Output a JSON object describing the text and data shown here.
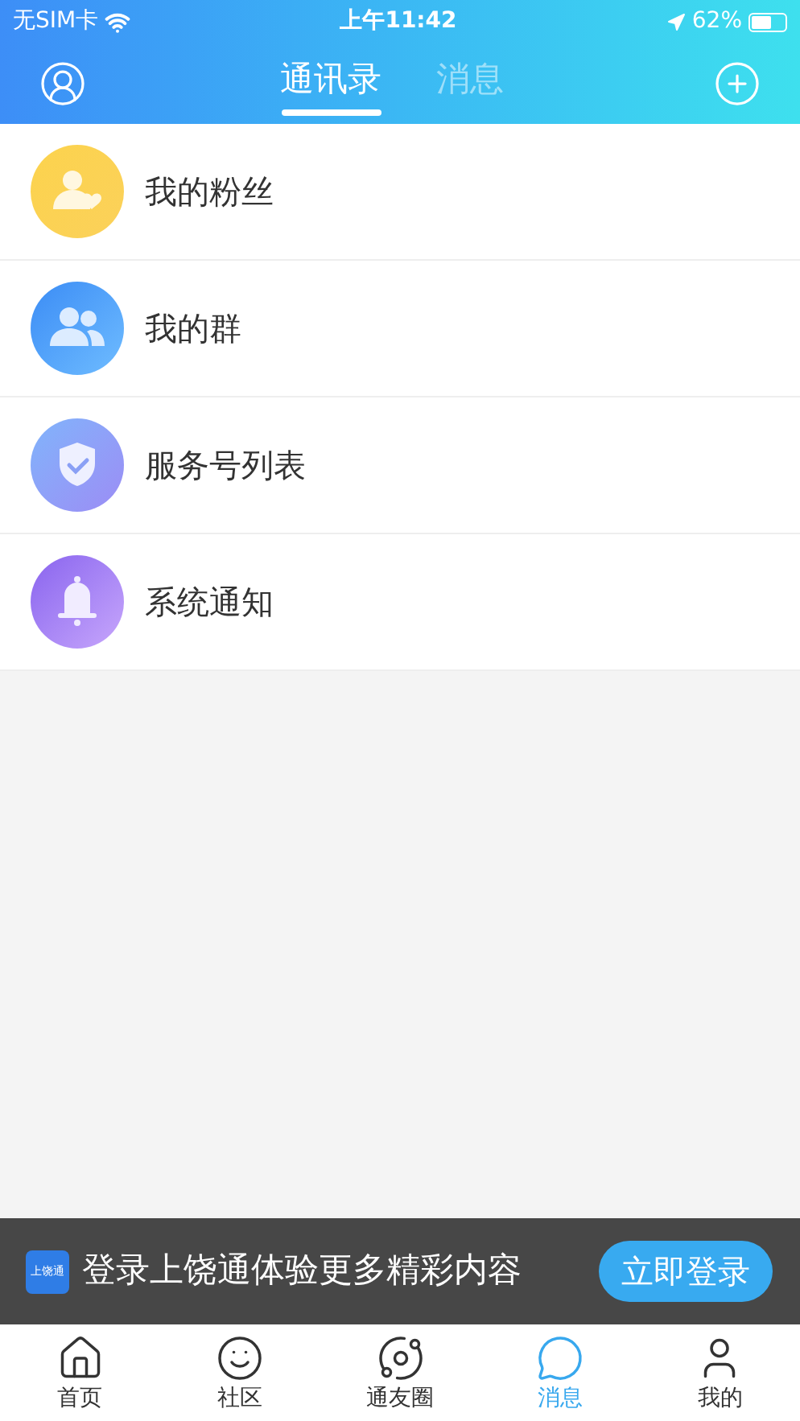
{
  "status_bar": {
    "carrier": "无SIM卡",
    "time": "上午11:42",
    "battery": "62%"
  },
  "header": {
    "tabs": [
      {
        "label": "通讯录",
        "selected": true
      },
      {
        "label": "消息",
        "selected": false
      }
    ]
  },
  "contacts": [
    {
      "kind": "fans",
      "label": "我的粉丝"
    },
    {
      "kind": "groups",
      "label": "我的群"
    },
    {
      "kind": "services",
      "label": "服务号列表"
    },
    {
      "kind": "notices",
      "label": "系统通知"
    }
  ],
  "login_banner": {
    "logo": "上饶通",
    "text": "登录上饶通体验更多精彩内容",
    "button": "立即登录"
  },
  "tab_bar": [
    {
      "kind": "home",
      "label": "首页",
      "selected": false
    },
    {
      "kind": "community",
      "label": "社区",
      "selected": false
    },
    {
      "kind": "circle",
      "label": "通友圈",
      "selected": false
    },
    {
      "kind": "messages",
      "label": "消息",
      "selected": true
    },
    {
      "kind": "me",
      "label": "我的",
      "selected": false
    }
  ]
}
